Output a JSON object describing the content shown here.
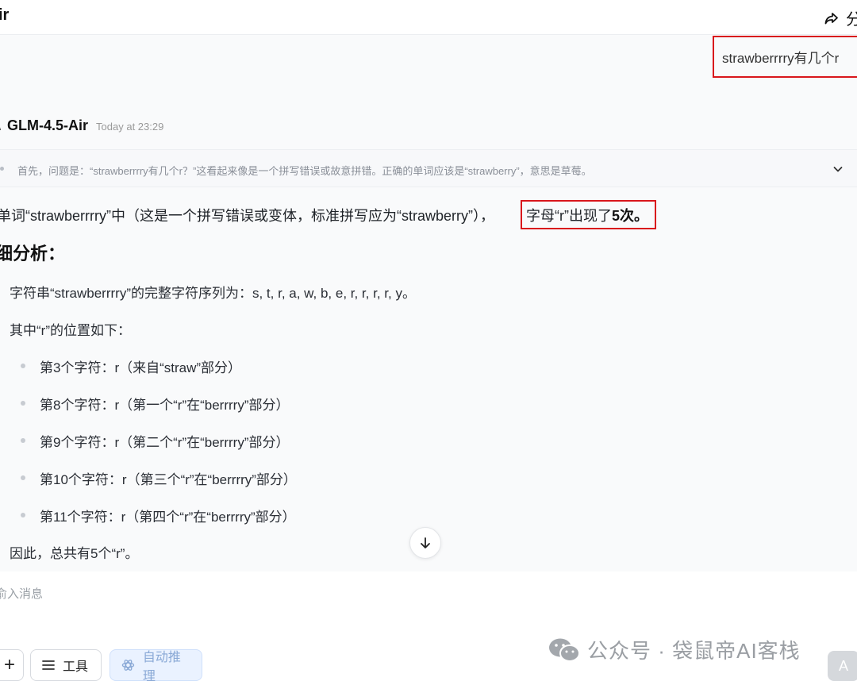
{
  "header": {
    "title": "ir",
    "share_label": "分"
  },
  "user_message": "strawberrrry有几个r",
  "model": {
    "avatar": "\\",
    "name": "GLM-4.5-Air",
    "time": "Today at 23:29"
  },
  "thinking": {
    "summary": "首先，问题是：“strawberrrry有几个r？”这看起来像是一个拼写错误或故意拼错。正确的单词应该是“strawberry”，意思是草莓。"
  },
  "answer": {
    "lead": "单词“strawberrrry”中（这是一个拼写错误或变体，标准拼写应为“strawberry”），",
    "highlight_prefix": "字母“r”出现了",
    "highlight_bold": "5次。",
    "heading": "细分析：",
    "para1": "字符串“strawberrrry”的完整字符序列为：s, t, r, a, w, b, e, r, r, r, r, y。",
    "para2": "其中“r”的位置如下：",
    "bullets": [
      "第3个字符：r（来自“straw”部分）",
      "第8个字符：r（第一个“r”在“berrrry”部分）",
      "第9个字符：r（第二个“r”在“berrrry”部分）",
      "第10个字符：r（第三个“r”在“berrrry”部分）",
      "第11个字符：r（第四个“r”在“berrrry”部分）"
    ],
    "conclusion": "因此，总共有5个“r”。"
  },
  "composer": {
    "placeholder": "俞入消息",
    "plus_label": "+",
    "tools_label": "工具",
    "auto_label": "自动推理"
  },
  "watermark": "公众号 · 袋鼠帝AI客栈",
  "corner_label": "A",
  "colors": {
    "highlight_border": "#d9161c",
    "auto_button_bg": "#eaf2ff"
  }
}
